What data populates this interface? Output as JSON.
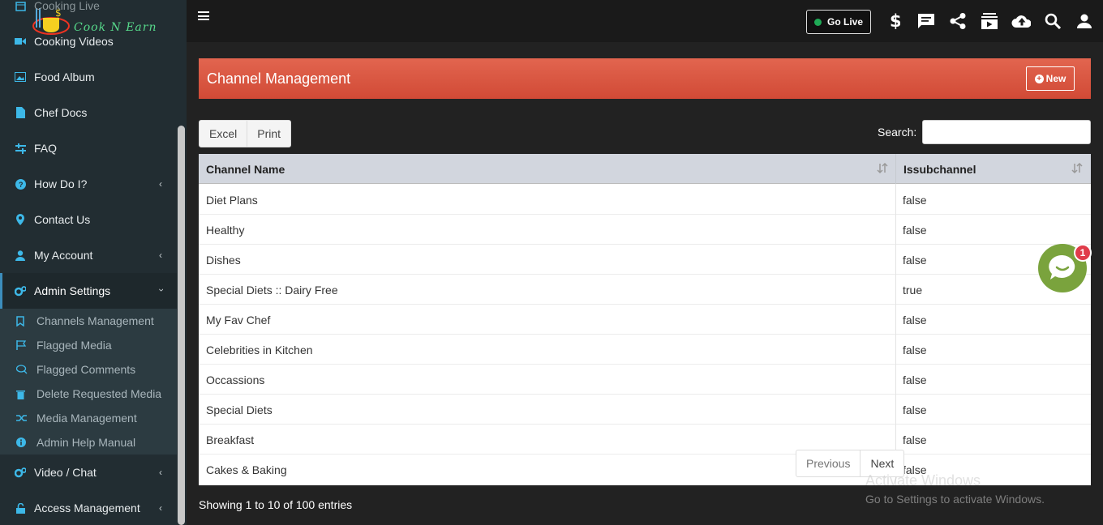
{
  "brand": {
    "logo_text": "Cook N Earn"
  },
  "sidebar": {
    "items": [
      {
        "label": "Cooking Live",
        "icon": "calendar-icon"
      },
      {
        "label": "Cooking Videos",
        "icon": "video-camera-icon"
      },
      {
        "label": "Food Album",
        "icon": "image-icon"
      },
      {
        "label": "Chef Docs",
        "icon": "document-icon"
      },
      {
        "label": "FAQ",
        "icon": "sliders-icon"
      },
      {
        "label": "How Do I?",
        "icon": "question-circle-icon"
      },
      {
        "label": "Contact Us",
        "icon": "map-marker-icon"
      },
      {
        "label": "My Account",
        "icon": "user-icon"
      },
      {
        "label": "Admin Settings",
        "icon": "cogs-icon"
      },
      {
        "label": "Video / Chat",
        "icon": "cogs-icon"
      },
      {
        "label": "Access Management",
        "icon": "lock-icon"
      }
    ],
    "submenu": [
      {
        "label": "Channels Management",
        "icon": "bookmark-icon"
      },
      {
        "label": "Flagged Media",
        "icon": "flag-icon"
      },
      {
        "label": "Flagged Comments",
        "icon": "comments-icon"
      },
      {
        "label": "Delete Requested Media",
        "icon": "trash-icon"
      },
      {
        "label": "Media Management",
        "icon": "random-icon"
      },
      {
        "label": "Admin Help Manual",
        "icon": "info-circle-icon"
      }
    ]
  },
  "topbar": {
    "go_live_label": "Go Live",
    "icons": [
      "dollar-icon",
      "chat-icon",
      "share-icon",
      "subscriptions-icon",
      "upload-cloud-icon",
      "search-icon",
      "user-icon"
    ]
  },
  "page": {
    "title": "Channel Management",
    "new_button": "New",
    "excel_button": "Excel",
    "print_button": "Print",
    "search_label": "Search:",
    "search_value": ""
  },
  "table": {
    "columns": [
      "Channel Name",
      "Issubchannel"
    ],
    "rows": [
      [
        "Diet Plans",
        "false"
      ],
      [
        "Healthy",
        "false"
      ],
      [
        "Dishes",
        "false"
      ],
      [
        "Special Diets :: Dairy Free",
        "true"
      ],
      [
        "My Fav Chef",
        "false"
      ],
      [
        "Celebrities in Kitchen",
        "false"
      ],
      [
        "Occassions",
        "false"
      ],
      [
        "Special Diets",
        "false"
      ],
      [
        "Breakfast",
        "false"
      ],
      [
        "Cakes & Baking",
        "false"
      ]
    ],
    "info": "Showing 1 to 10 of 100 entries",
    "previous": "Previous",
    "next": "Next"
  },
  "chat_widget": {
    "badge": "1"
  },
  "watermark": {
    "line1": "Activate Windows",
    "line2": "Go to Settings to activate Windows."
  },
  "colors": {
    "header": "#d9533e",
    "sidebar": "#222d32",
    "accent": "#3c8dbc",
    "chat": "#7aa33d"
  }
}
